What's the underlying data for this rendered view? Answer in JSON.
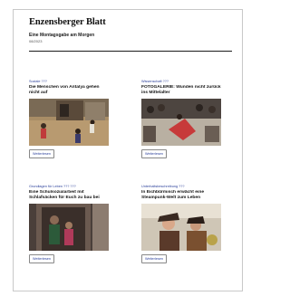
{
  "masthead": {
    "title": "Enzensberger Blatt",
    "subtitle": "Eine Montagsgabe am Morgen",
    "small": "08/2023"
  },
  "articles": [
    {
      "kicker": "Soziale ???",
      "headline": "Die Menschen von Antalya gehen nicht auf",
      "button": "Weiterlesen",
      "photo": "street-children-photo"
    },
    {
      "kicker": "Wissenschaft ???",
      "headline": "FOTOGALERIE: Wunden nicht zurück ins Mittelalter",
      "button": "Weiterlesen",
      "photo": "dancer-crowd-photo"
    },
    {
      "kicker": "Grundlagen für Leben ??? ???",
      "headline": "Eine Schulsozialarbeit mit Schlafsäcken für Euch zu bau bei",
      "button": "Weiterlesen",
      "photo": "family-doorway-photo"
    },
    {
      "kicker": "Unterhaltsbeschreibung ???",
      "headline": "In Eichbürmisch erwächt eine Steampunk-Welt zum Leben",
      "button": "Weiterlesen",
      "photo": "costume-portrait-photo"
    }
  ]
}
